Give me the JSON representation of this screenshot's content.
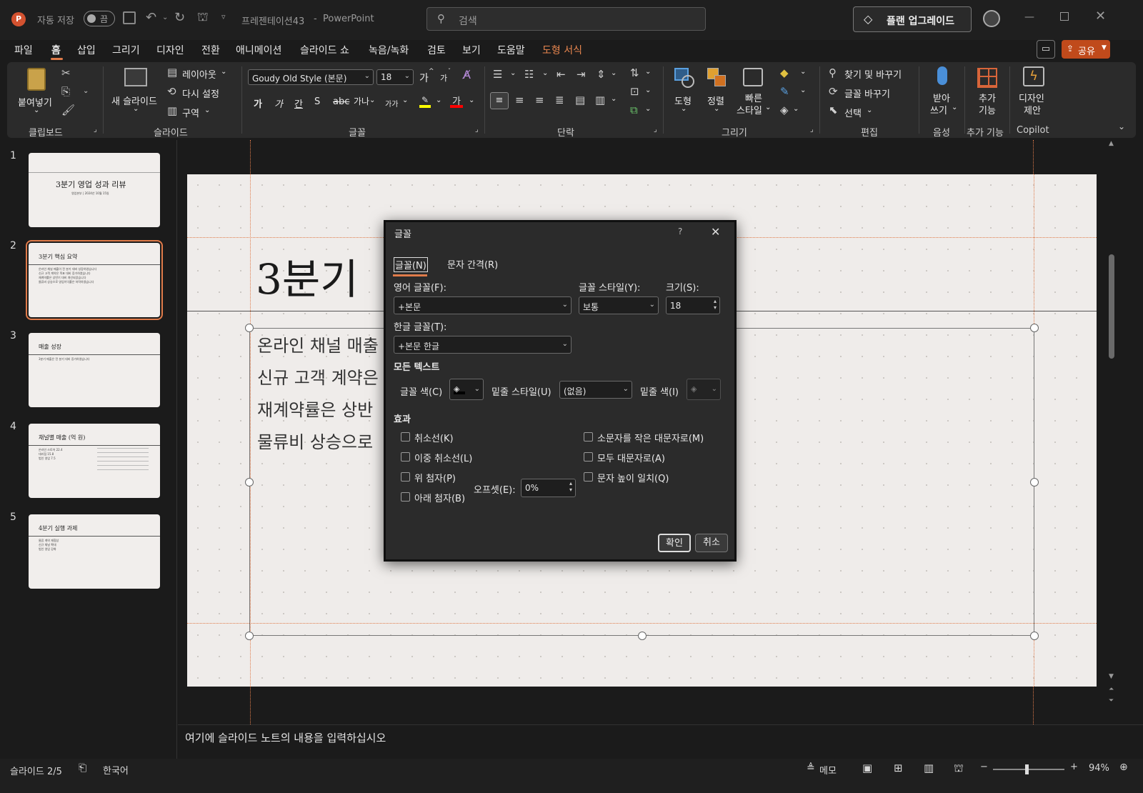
{
  "titlebar": {
    "autosave": "자동 저장",
    "toggle": "끔",
    "doc": "프레젠테이션43",
    "sep": "-",
    "app": "PowerPoint",
    "search_placeholder": "검색",
    "upgrade": "플랜 업그레이드"
  },
  "tabs": [
    "파일",
    "홈",
    "삽입",
    "그리기",
    "디자인",
    "전환",
    "애니메이션",
    "슬라이드 쇼",
    "녹음/녹화",
    "검토",
    "보기",
    "도움말",
    "도형 서식"
  ],
  "share": "공유",
  "ribbon": {
    "clipboard": {
      "paste": "붙여넣기",
      "label": "클립보드"
    },
    "slides": {
      "new_slide": "새 슬라이드",
      "layout": "레이아웃",
      "reset": "다시 설정",
      "section": "구역",
      "label": "슬라이드"
    },
    "font": {
      "font_name": "Goudy Old Style (본문)",
      "font_size": "18",
      "grow": "가",
      "shrink": "가",
      "bold": "가",
      "italic": "가",
      "underline": "간",
      "strike": "S",
      "spacing": "가나",
      "case": "가가",
      "label": "글꼴"
    },
    "paragraph": {
      "label": "단락"
    },
    "drawing": {
      "shapes": "도형",
      "arrange": "정렬",
      "quick_line1": "빠른",
      "quick_line2": "스타일",
      "label": "그리기"
    },
    "editing": {
      "find": "찾기 및 바꾸기",
      "replace": "글꼴 바꾸기",
      "select": "선택",
      "label": "편집"
    },
    "voice": {
      "dictate_line1": "받아",
      "dictate_line2": "쓰기",
      "label": "음성"
    },
    "addins": {
      "addins_line1": "추가",
      "addins_line2": "기능",
      "label": "추가 기능"
    },
    "copilot": {
      "designer_line1": "디자인",
      "designer_line2": "제안",
      "label": "Copilot"
    }
  },
  "slides": [
    {
      "num": "1",
      "title": "3분기 영업 성과 리뷰",
      "body": "영업본부 | 2024년 10월 15일"
    },
    {
      "num": "2",
      "title": "3분기 핵심 요약",
      "body": "온라인 채널 매출이 전 분기 대비 성장하였습니다\n신규 고객 계약은 목표 대비 증가하였습니다\n재계약률은 상반기 대비 개선되었습니다\n물류비 상승으로 영업이익률은 하락하였습니다"
    },
    {
      "num": "3",
      "title": "매출 성장",
      "body": "3분기 매출은 전 분기 대비 증가하였습니다"
    },
    {
      "num": "4",
      "title": "채널별 매출 (억 원)",
      "body": "온라인 스토어 22.4\n대리점 15.8\n법인 영업 7.5"
    },
    {
      "num": "5",
      "title": "4분기 실행 과제",
      "body": "물류 계약 재협상\n신규 채널 확대\n법인 영업 강화"
    }
  ],
  "main_slide": {
    "title": "3분기",
    "body": [
      "온라인 채널 매출",
      "신규 고객 계약은",
      "재계약률은 상반",
      "물류비 상승으로"
    ]
  },
  "dialog": {
    "title": "글꼴",
    "help": "?",
    "tab_font": "글꼴(N)",
    "tab_spacing": "문자 간격(R)",
    "latin_label": "영어 글꼴(F):",
    "latin_value": "+본문",
    "style_label": "글꼴 스타일(Y):",
    "style_value": "보통",
    "size_label": "크기(S):",
    "size_value": "18",
    "asian_label": "한글 글꼴(T):",
    "asian_value": "+본문 한글",
    "all_text": "모든 텍스트",
    "color_label": "글꼴 색(C)",
    "underline_label": "밑줄 스타일(U)",
    "underline_value": "(없음)",
    "underline_color": "밑줄 색(I)",
    "effects": "효과",
    "strike": "취소선(K)",
    "double_strike": "이중 취소선(L)",
    "superscript": "위 첨자(P)",
    "subscript": "아래 첨자(B)",
    "offset_label": "오프셋(E):",
    "offset_value": "0%",
    "small_caps": "소문자를 작은 대문자로(M)",
    "all_caps": "모두 대문자로(A)",
    "equalize": "문자 높이 일치(Q)",
    "ok": "확인",
    "cancel": "취소"
  },
  "notes_placeholder": "여기에 슬라이드 노트의 내용을 입력하십시오",
  "status": {
    "slide": "슬라이드 2/5",
    "language": "한국어",
    "notes": "메모",
    "zoom": "94%"
  },
  "colors": {
    "accent": "#e07b4a",
    "font_color": "#ff0000",
    "highlight": "#ffff00",
    "share_bg": "#c04a1b"
  }
}
